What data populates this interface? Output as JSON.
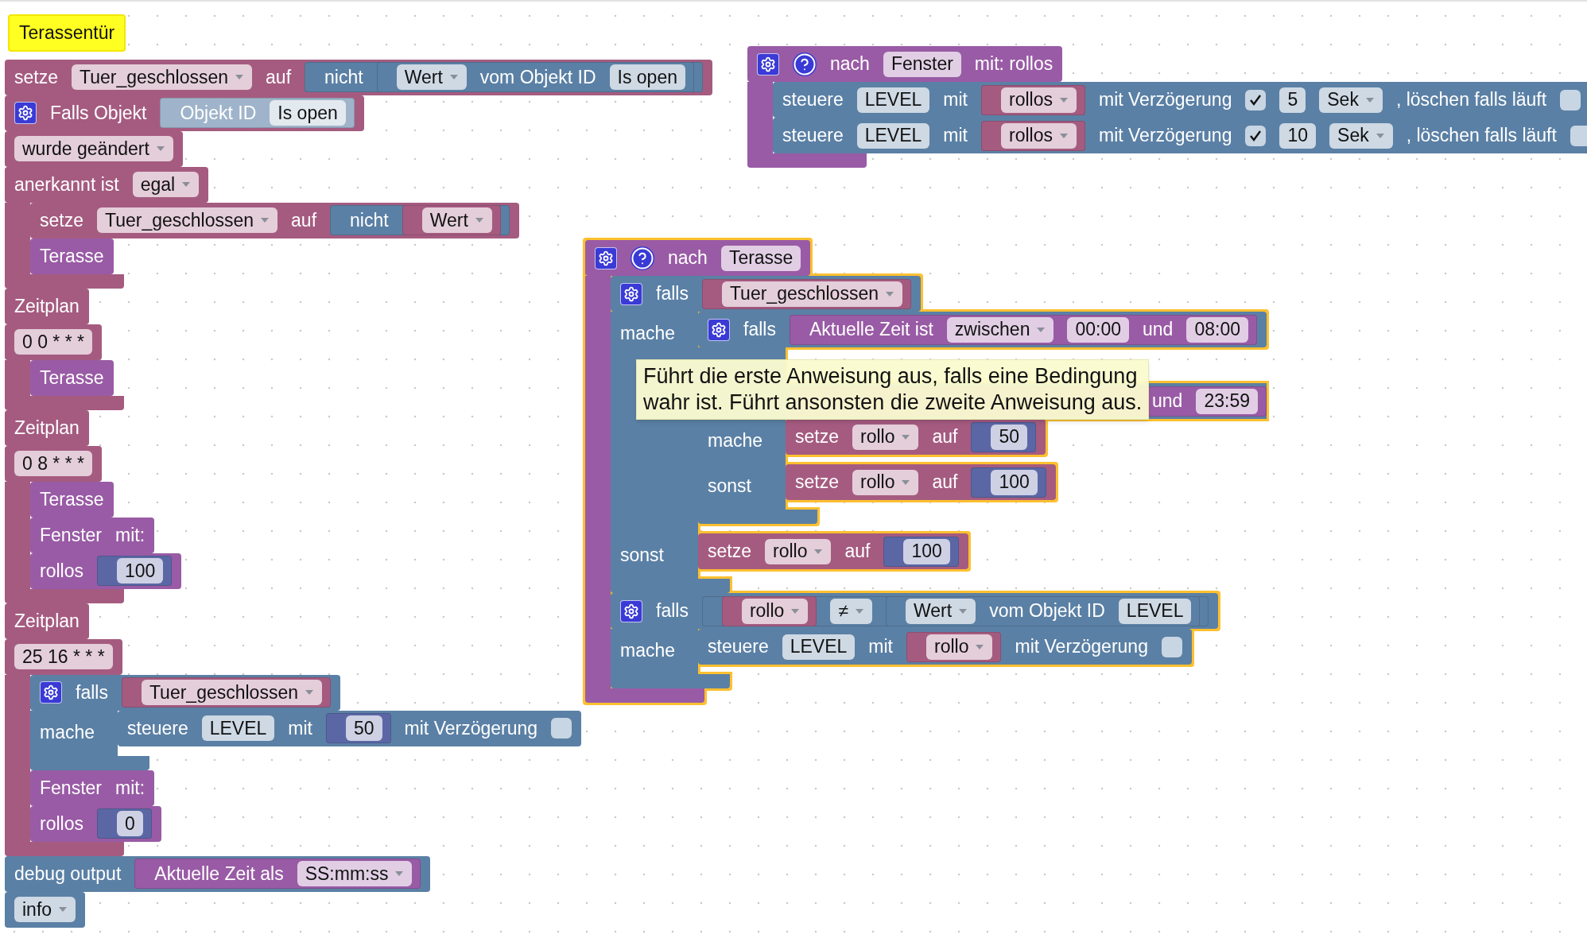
{
  "workspace": {
    "stacks": [
      {
        "selected": false,
        "comment": {
          "text": "Terassentür"
        },
        "blocks": [
          {
            "color": "#a55b80",
            "rows": [
              {
                "kind": "fields",
                "items": [
                  {
                    "kind": "label",
                    "text": "setze"
                  },
                  {
                    "kind": "dropdown",
                    "text": "Tuer_geschlossen"
                  },
                  {
                    "kind": "label",
                    "text": "auf"
                  },
                  {
                    "kind": "input",
                    "block": {
                      "color": "#5b80a5",
                      "items": [
                        {
                          "kind": "label",
                          "text": "nicht"
                        },
                        {
                          "kind": "input",
                          "block": {
                            "color": "#5b80a5",
                            "items": [
                              {
                                "kind": "dropdown",
                                "text": "Wert"
                              },
                              {
                                "kind": "label",
                                "text": "vom Objekt ID"
                              },
                              {
                                "kind": "field",
                                "text": "Is open"
                              }
                            ]
                          }
                        }
                      ]
                    }
                  }
                ]
              }
            ]
          },
          {
            "color": "#a55b80",
            "rows": [
              {
                "kind": "fields",
                "items": [
                  {
                    "kind": "gear"
                  },
                  {
                    "kind": "label",
                    "text": "Falls Objekt"
                  },
                  {
                    "kind": "input",
                    "block": {
                      "color": "#9fb4ca",
                      "items": [
                        {
                          "kind": "label",
                          "text": "Objekt ID"
                        },
                        {
                          "kind": "field",
                          "text": "Is open"
                        }
                      ]
                    }
                  }
                ]
              },
              {
                "kind": "fields",
                "items": [
                  {
                    "kind": "dropdown",
                    "text": "wurde geändert"
                  }
                ]
              },
              {
                "kind": "fields",
                "items": [
                  {
                    "kind": "label",
                    "text": "anerkannt ist"
                  },
                  {
                    "kind": "dropdown",
                    "text": "egal"
                  }
                ]
              },
              {
                "kind": "statement",
                "blocks": [
                  {
                    "color": "#a55b80",
                    "rows": [
                      {
                        "kind": "fields",
                        "items": [
                          {
                            "kind": "label",
                            "text": "setze"
                          },
                          {
                            "kind": "dropdown",
                            "text": "Tuer_geschlossen"
                          },
                          {
                            "kind": "label",
                            "text": "auf"
                          },
                          {
                            "kind": "input",
                            "block": {
                              "color": "#5b80a5",
                              "items": [
                                {
                                  "kind": "label",
                                  "text": "nicht"
                                },
                                {
                                  "kind": "input",
                                  "block": {
                                    "color": "#a55b80",
                                    "items": [
                                      {
                                        "kind": "dropdown",
                                        "text": "Wert"
                                      }
                                    ]
                                  }
                                }
                              ]
                            }
                          }
                        ]
                      }
                    ]
                  },
                  {
                    "color": "#995ba5",
                    "rows": [
                      {
                        "kind": "fields",
                        "items": [
                          {
                            "kind": "label",
                            "text": "Terasse"
                          }
                        ]
                      }
                    ]
                  }
                ]
              }
            ]
          },
          {
            "color": "#a55b80",
            "rows": [
              {
                "kind": "fields",
                "items": [
                  {
                    "kind": "label",
                    "text": "Zeitplan"
                  }
                ]
              },
              {
                "kind": "fields",
                "items": [
                  {
                    "kind": "field",
                    "text": "0 0 * * *"
                  }
                ]
              },
              {
                "kind": "statement",
                "blocks": [
                  {
                    "color": "#995ba5",
                    "rows": [
                      {
                        "kind": "fields",
                        "items": [
                          {
                            "kind": "label",
                            "text": "Terasse"
                          }
                        ]
                      }
                    ]
                  }
                ]
              }
            ]
          },
          {
            "color": "#a55b80",
            "rows": [
              {
                "kind": "fields",
                "items": [
                  {
                    "kind": "label",
                    "text": "Zeitplan"
                  }
                ]
              },
              {
                "kind": "fields",
                "items": [
                  {
                    "kind": "field",
                    "text": "0 8 * * *"
                  }
                ]
              },
              {
                "kind": "statement",
                "blocks": [
                  {
                    "color": "#995ba5",
                    "rows": [
                      {
                        "kind": "fields",
                        "items": [
                          {
                            "kind": "label",
                            "text": "Terasse"
                          }
                        ]
                      }
                    ]
                  },
                  {
                    "color": "#995ba5",
                    "rows": [
                      {
                        "kind": "fields",
                        "items": [
                          {
                            "kind": "label",
                            "text": "Fenster"
                          },
                          {
                            "kind": "label",
                            "text": "mit:"
                          }
                        ]
                      },
                      {
                        "kind": "fields",
                        "items": [
                          {
                            "kind": "label",
                            "text": "rollos"
                          },
                          {
                            "kind": "input",
                            "block": {
                              "color": "#5b67a5",
                              "items": [
                                {
                                  "kind": "field",
                                  "text": "100"
                                }
                              ]
                            }
                          }
                        ]
                      }
                    ]
                  }
                ]
              }
            ]
          },
          {
            "color": "#a55b80",
            "rows": [
              {
                "kind": "fields",
                "items": [
                  {
                    "kind": "label",
                    "text": "Zeitplan"
                  }
                ]
              },
              {
                "kind": "fields",
                "items": [
                  {
                    "kind": "field",
                    "text": "25 16 * * *"
                  }
                ]
              },
              {
                "kind": "statement",
                "blocks": [
                  {
                    "color": "#5b80a5",
                    "rows": [
                      {
                        "kind": "fields",
                        "items": [
                          {
                            "kind": "gear"
                          },
                          {
                            "kind": "label",
                            "text": "falls"
                          },
                          {
                            "kind": "input",
                            "block": {
                              "color": "#a55b80",
                              "items": [
                                {
                                  "kind": "dropdown",
                                  "text": "Tuer_geschlossen"
                                }
                              ]
                            }
                          }
                        ]
                      },
                      {
                        "kind": "statement",
                        "label": "mache",
                        "blocks": [
                          {
                            "color": "#5b80a5",
                            "rows": [
                              {
                                "kind": "fields",
                                "items": [
                                  {
                                    "kind": "label",
                                    "text": "steuere"
                                  },
                                  {
                                    "kind": "field",
                                    "text": "LEVEL"
                                  },
                                  {
                                    "kind": "label",
                                    "text": "mit"
                                  },
                                  {
                                    "kind": "input",
                                    "block": {
                                      "color": "#5b67a5",
                                      "items": [
                                        {
                                          "kind": "field",
                                          "text": "50"
                                        }
                                      ]
                                    }
                                  },
                                  {
                                    "kind": "label",
                                    "text": "mit Verzögerung"
                                  },
                                  {
                                    "kind": "checkbox",
                                    "checked": false
                                  }
                                ]
                              }
                            ]
                          }
                        ]
                      }
                    ]
                  },
                  {
                    "color": "#995ba5",
                    "rows": [
                      {
                        "kind": "fields",
                        "items": [
                          {
                            "kind": "label",
                            "text": "Fenster"
                          },
                          {
                            "kind": "label",
                            "text": "mit:"
                          }
                        ]
                      },
                      {
                        "kind": "fields",
                        "items": [
                          {
                            "kind": "label",
                            "text": "rollos"
                          },
                          {
                            "kind": "input",
                            "block": {
                              "color": "#5b67a5",
                              "items": [
                                {
                                  "kind": "field",
                                  "text": "0"
                                }
                              ]
                            }
                          }
                        ]
                      }
                    ]
                  }
                ]
              }
            ]
          },
          {
            "color": "#5b80a5",
            "rows": [
              {
                "kind": "fields",
                "items": [
                  {
                    "kind": "label",
                    "text": "debug output"
                  },
                  {
                    "kind": "input",
                    "block": {
                      "color": "#995ba5",
                      "items": [
                        {
                          "kind": "label",
                          "text": "Aktuelle Zeit als"
                        },
                        {
                          "kind": "dropdown",
                          "text": "SS:mm:ss"
                        }
                      ]
                    }
                  }
                ]
              },
              {
                "kind": "fields",
                "items": [
                  {
                    "kind": "dropdown",
                    "text": "info"
                  }
                ]
              }
            ]
          }
        ]
      },
      {
        "selected": false,
        "blocks": [
          {
            "color": "#995ba5",
            "rows": [
              {
                "kind": "fields",
                "items": [
                  {
                    "kind": "gear"
                  },
                  {
                    "kind": "help"
                  },
                  {
                    "kind": "label",
                    "text": "nach"
                  },
                  {
                    "kind": "field",
                    "text": "Fenster"
                  },
                  {
                    "kind": "label",
                    "text": "mit: rollos"
                  }
                ]
              },
              {
                "kind": "statement",
                "blocks": [
                  {
                    "color": "#5b80a5",
                    "rows": [
                      {
                        "kind": "fields",
                        "items": [
                          {
                            "kind": "label",
                            "text": "steuere"
                          },
                          {
                            "kind": "field",
                            "text": "LEVEL"
                          },
                          {
                            "kind": "label",
                            "text": "mit"
                          },
                          {
                            "kind": "input",
                            "block": {
                              "color": "#a55b80",
                              "items": [
                                {
                                  "kind": "dropdown",
                                  "text": "rollos"
                                }
                              ]
                            }
                          },
                          {
                            "kind": "label",
                            "text": "mit Verzögerung"
                          },
                          {
                            "kind": "checkbox",
                            "checked": true
                          },
                          {
                            "kind": "field",
                            "text": "5"
                          },
                          {
                            "kind": "dropdown",
                            "text": "Sek"
                          },
                          {
                            "kind": "label",
                            "text": ", löschen falls läuft"
                          },
                          {
                            "kind": "checkbox",
                            "checked": false
                          }
                        ]
                      }
                    ]
                  },
                  {
                    "color": "#5b80a5",
                    "rows": [
                      {
                        "kind": "fields",
                        "items": [
                          {
                            "kind": "label",
                            "text": "steuere"
                          },
                          {
                            "kind": "field",
                            "text": "LEVEL"
                          },
                          {
                            "kind": "label",
                            "text": "mit"
                          },
                          {
                            "kind": "input",
                            "block": {
                              "color": "#a55b80",
                              "items": [
                                {
                                  "kind": "dropdown",
                                  "text": "rollos"
                                }
                              ]
                            }
                          },
                          {
                            "kind": "label",
                            "text": "mit Verzögerung"
                          },
                          {
                            "kind": "checkbox",
                            "checked": true
                          },
                          {
                            "kind": "field",
                            "text": "10"
                          },
                          {
                            "kind": "dropdown",
                            "text": "Sek"
                          },
                          {
                            "kind": "label",
                            "text": ", löschen falls läuft"
                          },
                          {
                            "kind": "checkbox",
                            "checked": false
                          }
                        ]
                      }
                    ]
                  }
                ]
              }
            ]
          }
        ]
      },
      {
        "selected": true,
        "blocks": [
          {
            "color": "#995ba5",
            "rows": [
              {
                "kind": "fields",
                "items": [
                  {
                    "kind": "gear"
                  },
                  {
                    "kind": "help"
                  },
                  {
                    "kind": "label",
                    "text": "nach"
                  },
                  {
                    "kind": "field",
                    "text": "Terasse"
                  }
                ]
              },
              {
                "kind": "statement",
                "blocks": [
                  {
                    "color": "#5b80a5",
                    "rows": [
                      {
                        "kind": "fields",
                        "items": [
                          {
                            "kind": "gear"
                          },
                          {
                            "kind": "label",
                            "text": "falls"
                          },
                          {
                            "kind": "input",
                            "block": {
                              "color": "#a55b80",
                              "items": [
                                {
                                  "kind": "dropdown",
                                  "text": "Tuer_geschlossen"
                                }
                              ]
                            }
                          }
                        ]
                      },
                      {
                        "kind": "statement",
                        "label": "mache",
                        "blocks": [
                          {
                            "color": "#5b80a5",
                            "rows": [
                              {
                                "kind": "fields",
                                "items": [
                                  {
                                    "kind": "gear"
                                  },
                                  {
                                    "kind": "label",
                                    "text": "falls"
                                  },
                                  {
                                    "kind": "input",
                                    "block": {
                                      "color": "#995ba5",
                                      "items": [
                                        {
                                          "kind": "label",
                                          "text": "Aktuelle Zeit ist"
                                        },
                                        {
                                          "kind": "dropdown",
                                          "text": "zwischen"
                                        },
                                        {
                                          "kind": "field",
                                          "text": "00:00"
                                        },
                                        {
                                          "kind": "label",
                                          "text": "und"
                                        },
                                        {
                                          "kind": "field",
                                          "text": "08:00"
                                        }
                                      ]
                                    }
                                  }
                                ]
                              },
                              {
                                "kind": "covered"
                              },
                              {
                                "kind": "continued",
                                "block": {
                                  "color": "#995ba5",
                                  "items": [
                                    {
                                      "kind": "label",
                                      "text": "und"
                                    },
                                    {
                                      "kind": "field",
                                      "text": "23:59"
                                    }
                                  ]
                                }
                              },
                              {
                                "kind": "statement",
                                "label": "mache",
                                "blocks": [
                                  {
                                    "color": "#a55b80",
                                    "rows": [
                                      {
                                        "kind": "fields",
                                        "items": [
                                          {
                                            "kind": "label",
                                            "text": "setze"
                                          },
                                          {
                                            "kind": "dropdown",
                                            "text": "rollo"
                                          },
                                          {
                                            "kind": "label",
                                            "text": "auf"
                                          },
                                          {
                                            "kind": "input",
                                            "block": {
                                              "color": "#5b67a5",
                                              "items": [
                                                {
                                                  "kind": "field",
                                                  "text": "50"
                                                }
                                              ]
                                            }
                                          }
                                        ]
                                      }
                                    ]
                                  }
                                ]
                              },
                              {
                                "kind": "statement",
                                "label": "sonst",
                                "blocks": [
                                  {
                                    "color": "#a55b80",
                                    "rows": [
                                      {
                                        "kind": "fields",
                                        "items": [
                                          {
                                            "kind": "label",
                                            "text": "setze"
                                          },
                                          {
                                            "kind": "dropdown",
                                            "text": "rollo"
                                          },
                                          {
                                            "kind": "label",
                                            "text": "auf"
                                          },
                                          {
                                            "kind": "input",
                                            "block": {
                                              "color": "#5b67a5",
                                              "items": [
                                                {
                                                  "kind": "field",
                                                  "text": "100"
                                                }
                                              ]
                                            }
                                          }
                                        ]
                                      }
                                    ]
                                  }
                                ]
                              }
                            ]
                          }
                        ]
                      },
                      {
                        "kind": "statement",
                        "label": "sonst",
                        "blocks": [
                          {
                            "color": "#a55b80",
                            "rows": [
                              {
                                "kind": "fields",
                                "items": [
                                  {
                                    "kind": "label",
                                    "text": "setze"
                                  },
                                  {
                                    "kind": "dropdown",
                                    "text": "rollo"
                                  },
                                  {
                                    "kind": "label",
                                    "text": "auf"
                                  },
                                  {
                                    "kind": "input",
                                    "block": {
                                      "color": "#5b67a5",
                                      "items": [
                                        {
                                          "kind": "field",
                                          "text": "100"
                                        }
                                      ]
                                    }
                                  }
                                ]
                              }
                            ]
                          }
                        ]
                      }
                    ]
                  },
                  {
                    "color": "#5b80a5",
                    "rows": [
                      {
                        "kind": "fields",
                        "items": [
                          {
                            "kind": "gear"
                          },
                          {
                            "kind": "label",
                            "text": "falls"
                          },
                          {
                            "kind": "input",
                            "block": {
                              "color": "#5b80a5",
                              "items": [
                                {
                                  "kind": "input",
                                  "block": {
                                    "color": "#a55b80",
                                    "items": [
                                      {
                                        "kind": "dropdown",
                                        "text": "rollo"
                                      }
                                    ]
                                  }
                                },
                                {
                                  "kind": "dropdown",
                                  "text": "≠"
                                },
                                {
                                  "kind": "input",
                                  "block": {
                                    "color": "#5b80a5",
                                    "items": [
                                      {
                                        "kind": "dropdown",
                                        "text": "Wert"
                                      },
                                      {
                                        "kind": "label",
                                        "text": "vom Objekt ID"
                                      },
                                      {
                                        "kind": "field",
                                        "text": "LEVEL"
                                      }
                                    ]
                                  }
                                }
                              ]
                            }
                          }
                        ]
                      },
                      {
                        "kind": "statement",
                        "label": "mache",
                        "blocks": [
                          {
                            "color": "#5b80a5",
                            "rows": [
                              {
                                "kind": "fields",
                                "items": [
                                  {
                                    "kind": "label",
                                    "text": "steuere"
                                  },
                                  {
                                    "kind": "field",
                                    "text": "LEVEL"
                                  },
                                  {
                                    "kind": "label",
                                    "text": "mit"
                                  },
                                  {
                                    "kind": "input",
                                    "block": {
                                      "color": "#a55b80",
                                      "items": [
                                        {
                                          "kind": "dropdown",
                                          "text": "rollo"
                                        }
                                      ]
                                    }
                                  },
                                  {
                                    "kind": "label",
                                    "text": "mit Verzögerung"
                                  },
                                  {
                                    "kind": "checkbox",
                                    "checked": false
                                  }
                                ]
                              }
                            ]
                          }
                        ]
                      }
                    ]
                  }
                ]
              }
            ]
          }
        ]
      }
    ],
    "tooltip": {
      "lines": [
        "Führt die erste Anweisung aus, falls eine Bedingung",
        "wahr ist. Führt ansonsten die zweite Anweisung aus."
      ]
    }
  }
}
